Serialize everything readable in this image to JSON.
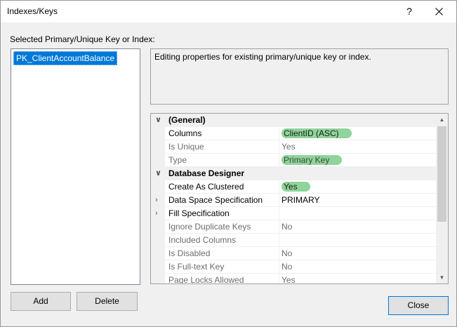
{
  "window": {
    "title": "Indexes/Keys",
    "help_label": "?"
  },
  "left": {
    "label": "Selected Primary/Unique Key or Index:",
    "items": [
      "PK_ClientAccountBalance"
    ]
  },
  "description": "Editing properties for existing primary/unique key or index.",
  "grid": {
    "categories": {
      "general": "(General)",
      "designer": "Database Designer"
    },
    "rows": {
      "columns": {
        "name": "Columns",
        "value": "ClientID (ASC)"
      },
      "is_unique": {
        "name": "Is Unique",
        "value": "Yes"
      },
      "type": {
        "name": "Type",
        "value": "Primary Key"
      },
      "create_clustered": {
        "name": "Create As Clustered",
        "value": "Yes"
      },
      "data_space": {
        "name": "Data Space Specification",
        "value": "PRIMARY"
      },
      "fill_spec": {
        "name": "Fill Specification",
        "value": ""
      },
      "ignore_dup": {
        "name": "Ignore Duplicate Keys",
        "value": "No"
      },
      "included": {
        "name": "Included Columns",
        "value": ""
      },
      "is_disabled": {
        "name": "Is Disabled",
        "value": "No"
      },
      "is_fulltext": {
        "name": "Is Full-text Key",
        "value": "No"
      },
      "page_locks": {
        "name": "Page Locks Allowed",
        "value": "Yes"
      }
    }
  },
  "buttons": {
    "add": "Add",
    "delete": "Delete",
    "close": "Close"
  },
  "icons": {
    "collapse": "chevron-down-icon",
    "expand": "chevron-right-icon",
    "close": "close-icon"
  },
  "colors": {
    "selection": "#0078d7",
    "highlight": "#8fd49a"
  }
}
